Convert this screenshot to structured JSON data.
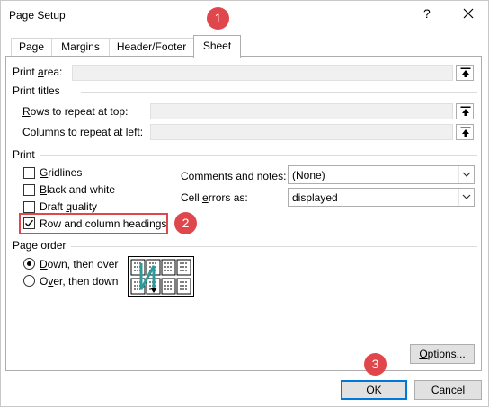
{
  "dialog": {
    "title": "Page Setup",
    "help_glyph": "?",
    "close_glyph": "✕"
  },
  "tabs": [
    {
      "label": "Page",
      "active": false
    },
    {
      "label": "Margins",
      "active": false
    },
    {
      "label": "Header/Footer",
      "active": false
    },
    {
      "label": "Sheet",
      "active": true
    }
  ],
  "print_area": {
    "label_prefix": "Print ",
    "label_accel": "a",
    "label_suffix": "rea:",
    "value": ""
  },
  "print_titles": {
    "header": "Print titles",
    "rows": {
      "accel": "R",
      "rest": "ows to repeat at top:",
      "value": ""
    },
    "columns": {
      "accel": "C",
      "rest": "olumns to repeat at left:",
      "value": ""
    }
  },
  "print": {
    "header": "Print",
    "gridlines": {
      "accel": "G",
      "rest": "ridlines",
      "checked": false
    },
    "black_white": {
      "accel": "B",
      "rest": "lack and white",
      "checked": false
    },
    "draft": {
      "pre": "Draft ",
      "accel": "q",
      "rest": "uality",
      "checked": false
    },
    "headings": {
      "label": "Row and column headings",
      "checked": true
    },
    "comments": {
      "pre": "Co",
      "accel": "m",
      "rest": "ments and notes:",
      "value": "(None)"
    },
    "cell_errors": {
      "pre": "Cell ",
      "accel": "e",
      "rest": "rrors as:",
      "value": "displayed"
    }
  },
  "page_order": {
    "header": "Page order",
    "down_over": {
      "accel": "D",
      "rest": "own, then over",
      "selected": true
    },
    "over_down": {
      "pre": "O",
      "accel": "v",
      "rest": "er, then down",
      "selected": false
    }
  },
  "buttons": {
    "options": {
      "accel": "O",
      "rest": "ptions..."
    },
    "ok": "OK",
    "cancel": "Cancel"
  },
  "annotations": [
    "1",
    "2",
    "3"
  ],
  "colors": {
    "annotation": "#e0474c",
    "accent": "#0078d7",
    "arrow": "#2e9a9a"
  },
  "icons": [
    "collapse-dialog-icon",
    "chevron-down-icon",
    "checkmark-icon",
    "close-icon",
    "page-order-preview"
  ]
}
